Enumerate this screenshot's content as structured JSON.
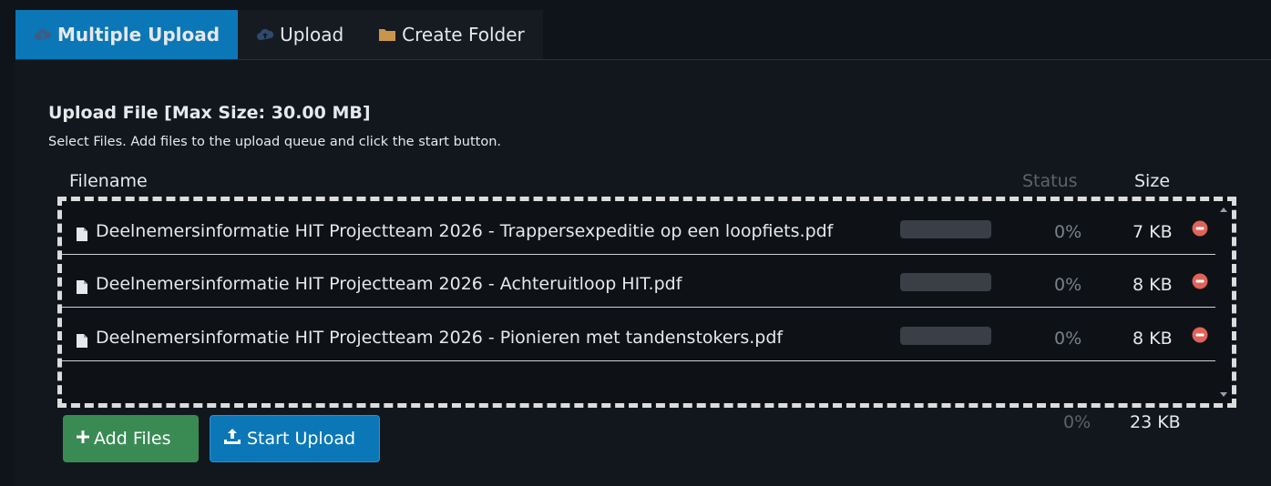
{
  "tabs": [
    {
      "label": "Multiple Upload",
      "icon": "cloud-upload-icon",
      "active": true
    },
    {
      "label": "Upload",
      "icon": "cloud-upload-icon",
      "active": false
    },
    {
      "label": "Create Folder",
      "icon": "folder-icon",
      "active": false
    }
  ],
  "upload": {
    "title": "Upload File [Max Size: 30.00 MB]",
    "subtitle": "Select Files. Add files to the upload queue and click the start button.",
    "columns": {
      "filename": "Filename",
      "status": "Status",
      "size": "Size"
    },
    "files": [
      {
        "name": "Deelnemersinformatie HIT Projectteam 2026 - Trappersexpeditie op een loopfiets.pdf",
        "progress": "0%",
        "progress_value": 0,
        "size": "7 KB"
      },
      {
        "name": "Deelnemersinformatie HIT Projectteam 2026 - Achteruitloop HIT.pdf",
        "progress": "0%",
        "progress_value": 0,
        "size": "8 KB"
      },
      {
        "name": "Deelnemersinformatie HIT Projectteam 2026 - Pionieren met tandenstokers.pdf",
        "progress": "0%",
        "progress_value": 0,
        "size": "8 KB"
      }
    ],
    "total": {
      "progress": "0%",
      "size": "23 KB"
    },
    "buttons": {
      "add": "Add Files",
      "start": "Start Upload"
    }
  },
  "colors": {
    "active_tab": "#0b77b7",
    "add_button": "#3a8a54",
    "start_button": "#0b77b7",
    "remove_icon": "#e0635a",
    "folder_icon": "#c8964a"
  }
}
